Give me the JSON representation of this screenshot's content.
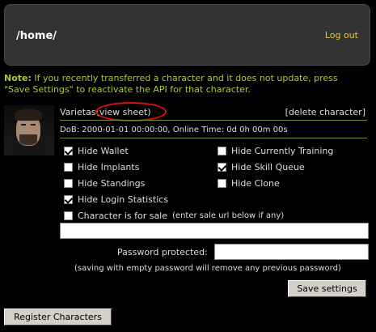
{
  "header": {
    "path": "/home/",
    "logout": "Log out"
  },
  "note": {
    "label": "Note:",
    "text": " If you recently transferred a character and it does not update, press \"Save Settings\" to reactivate the API for that character."
  },
  "character": {
    "name": "Varietas",
    "view_sheet": "(view sheet)",
    "delete": "[delete character]",
    "info": "DoB: 2000-01-01 00:00:00, Online Time: 0d 0h 00m 00s"
  },
  "options": [
    {
      "label": "Hide Wallet",
      "checked": true
    },
    {
      "label": "Hide Currently Training",
      "checked": false
    },
    {
      "label": "Hide Implants",
      "checked": false
    },
    {
      "label": "Hide Skill Queue",
      "checked": true
    },
    {
      "label": "Hide Standings",
      "checked": false
    },
    {
      "label": "Hide Clone",
      "checked": false
    },
    {
      "label": "Hide Login Statistics",
      "checked": true
    }
  ],
  "sale": {
    "label": "Character is for sale",
    "hint": "(enter sale url below if any)",
    "checked": false,
    "url": ""
  },
  "password": {
    "label": "Password protected:",
    "value": "",
    "note": "(saving with empty password will remove any previous password)"
  },
  "buttons": {
    "save": "Save settings",
    "register": "Register Characters"
  },
  "colors": {
    "accent_green": "#a6cc3a",
    "link_yellow": "#f0c040",
    "annotation_red": "#d11"
  }
}
